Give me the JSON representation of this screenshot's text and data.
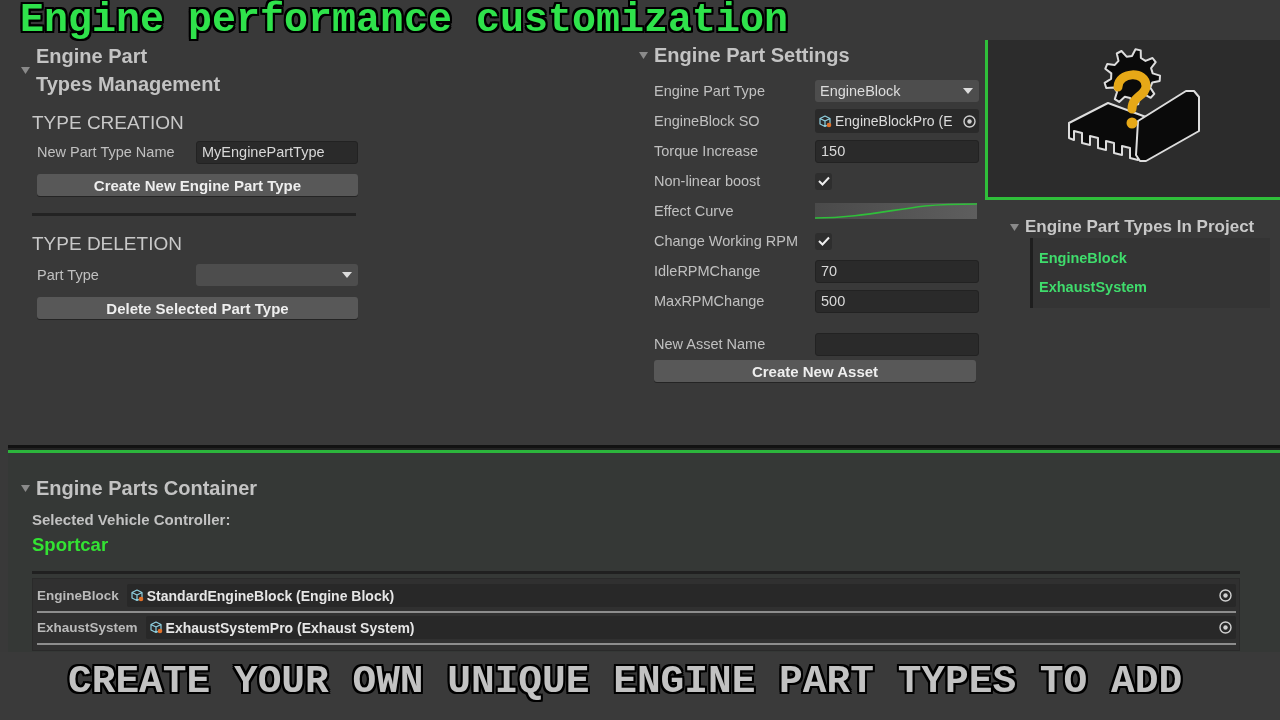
{
  "overlay_title": "Engine performance customization",
  "types_management": {
    "expanded": true,
    "title_lines": [
      "Engine Part",
      "Types Management"
    ],
    "creation": {
      "heading": "TYPE CREATION",
      "name_label": "New Part Type Name",
      "name_value": "MyEnginePartType",
      "button": "Create New Engine Part Type"
    },
    "deletion": {
      "heading": "TYPE DELETION",
      "part_type_label": "Part Type",
      "button": "Delete Selected Part Type"
    }
  },
  "part_settings": {
    "expanded": true,
    "title": "Engine Part Settings",
    "fields": [
      {
        "kind": "dropdown",
        "label": "Engine Part Type",
        "value": "EngineBlock"
      },
      {
        "kind": "object",
        "label": "EngineBlock SO",
        "value": "EngineBlockPro (E"
      },
      {
        "kind": "number",
        "label": "Torque Increase",
        "value": "150"
      },
      {
        "kind": "checkbox",
        "label": "Non-linear boost",
        "checked": true
      },
      {
        "kind": "curve",
        "label": "Effect Curve"
      },
      {
        "kind": "checkbox",
        "label": "Change Working RPM",
        "checked": true
      },
      {
        "kind": "number",
        "label": "IdleRPMChange",
        "value": "70"
      },
      {
        "kind": "number",
        "label": "MaxRPMChange",
        "value": "500"
      }
    ],
    "asset_name_label": "New Asset Name",
    "button": "Create New Asset"
  },
  "types_in_project": {
    "expanded": true,
    "title": "Engine Part Types In Project",
    "items": [
      "EngineBlock",
      "ExhaustSystem"
    ]
  },
  "parts_container": {
    "expanded": true,
    "title": "Engine Parts Container",
    "vehicle_label": "Selected Vehicle Controller:",
    "vehicle_value": "Sportcar",
    "slots": [
      {
        "label": "EngineBlock",
        "value": "StandardEngineBlock (Engine Block)"
      },
      {
        "label": "ExhaustSystem",
        "value": "ExhaustSystemPro (Exhaust System)"
      }
    ]
  },
  "caption": "CREATE YOUR OWN UNIQUE ENGINE PART TYPES TO ADD"
}
